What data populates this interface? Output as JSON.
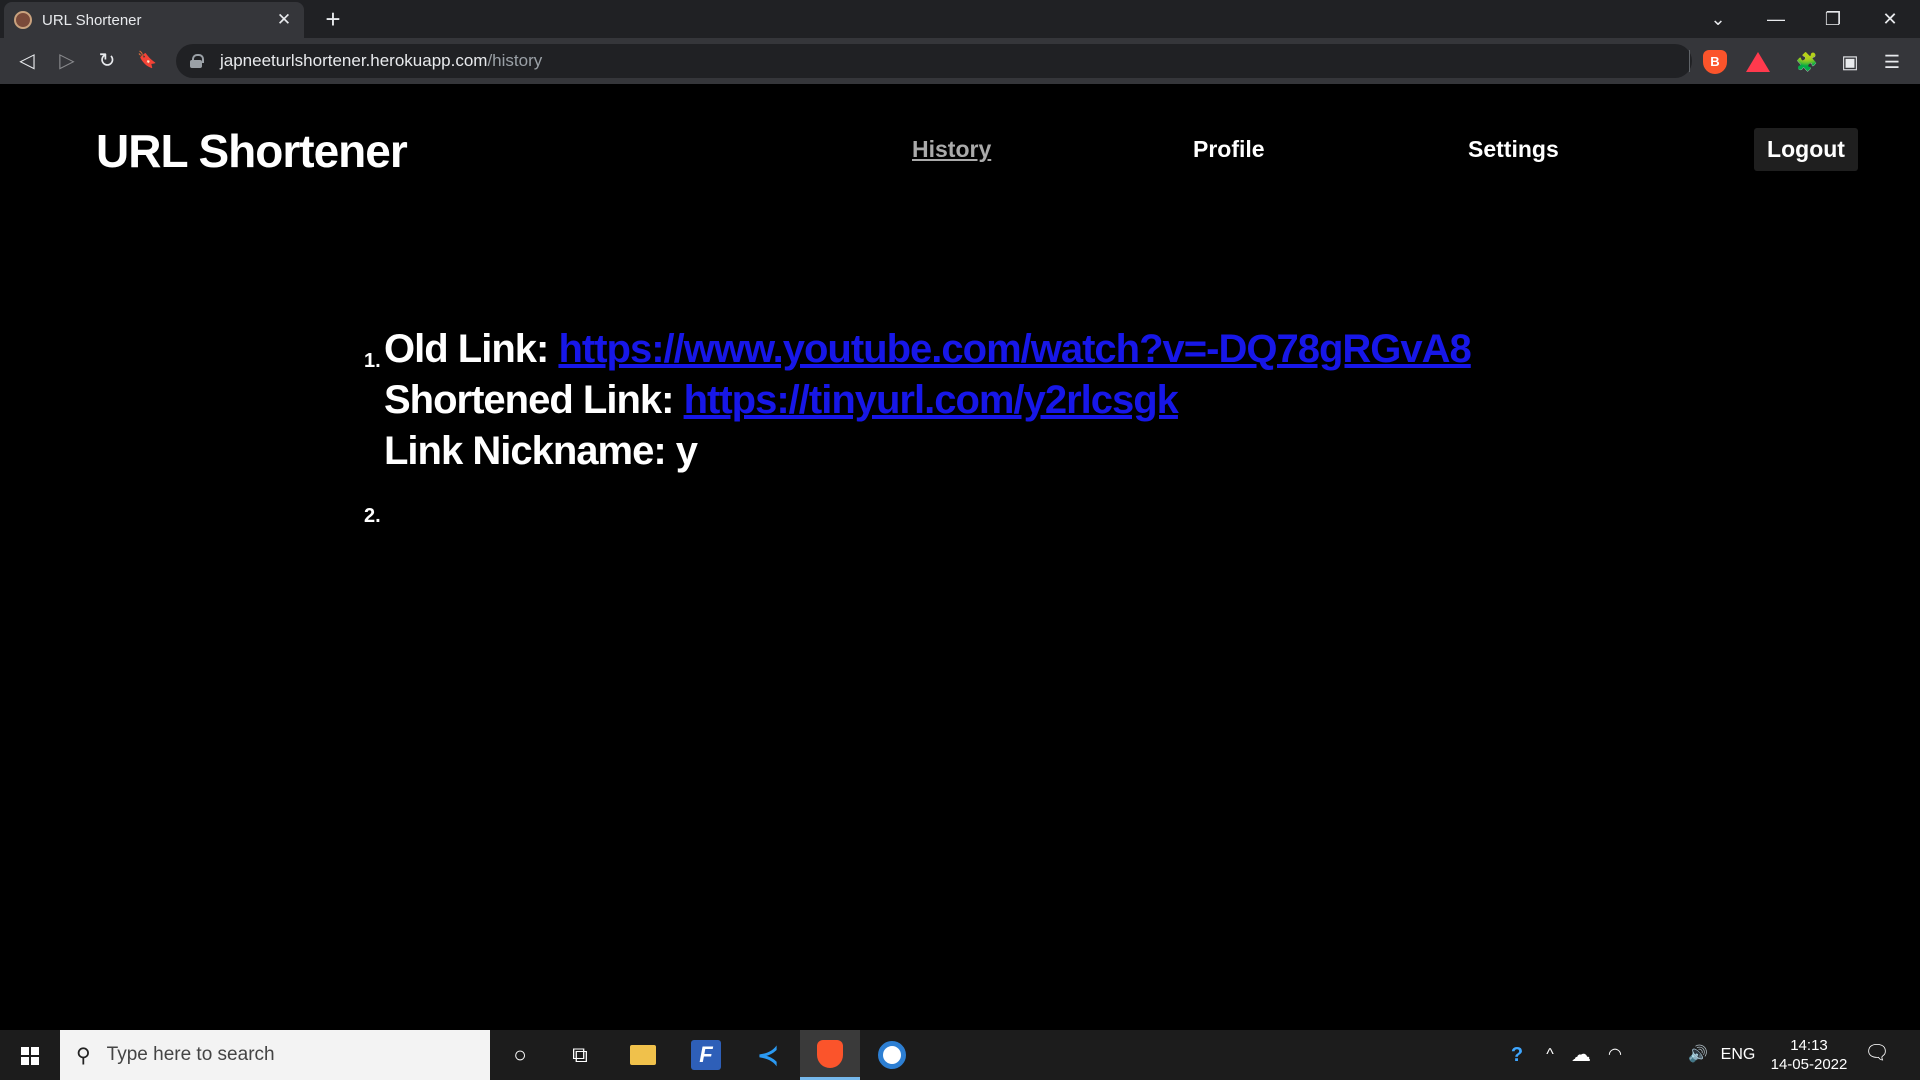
{
  "browser": {
    "tab_title": "URL Shortener",
    "tab_close": "✕",
    "new_tab": "+",
    "url_host": "japneeturlshortener.herokuapp.com",
    "url_path": "/history",
    "window_controls": {
      "dropdown": "⌄",
      "minimize": "—",
      "restore": "❐",
      "close": "✕"
    },
    "nav": {
      "back": "◁",
      "forward": "▷",
      "reload": "↻",
      "bookmark": "🔖"
    },
    "extensions": {
      "brave_label": "B",
      "puzzle": "🧩",
      "wallet": "▣",
      "menu": "☰"
    }
  },
  "site": {
    "logo": "URL Shortener",
    "nav": {
      "history": "History",
      "profile": "Profile",
      "settings": "Settings"
    },
    "logout": "Logout"
  },
  "history": [
    {
      "number": "1.",
      "old_label": "Old Link:",
      "old_url": "https://www.youtube.com/watch?v=-DQ78gRGvA8",
      "short_label": "Shortened Link:",
      "short_url": "https://tinyurl.com/y2rlcsgk",
      "nickname_label": "Link Nickname:",
      "nickname": "y"
    },
    {
      "number": "2."
    }
  ],
  "taskbar": {
    "search_placeholder": "Type here to search",
    "search_icon": "⚲",
    "cortana": "○",
    "taskview": "⧉",
    "feedback_letter": "F",
    "vscode_glyph": "≺",
    "tray": {
      "help": "?",
      "chevron": "^",
      "cloud": "☁",
      "language": "ENG",
      "volume": "🔊",
      "wifi": "◠"
    },
    "time": "14:13",
    "date": "14-05-2022",
    "notifications": "🗨"
  }
}
